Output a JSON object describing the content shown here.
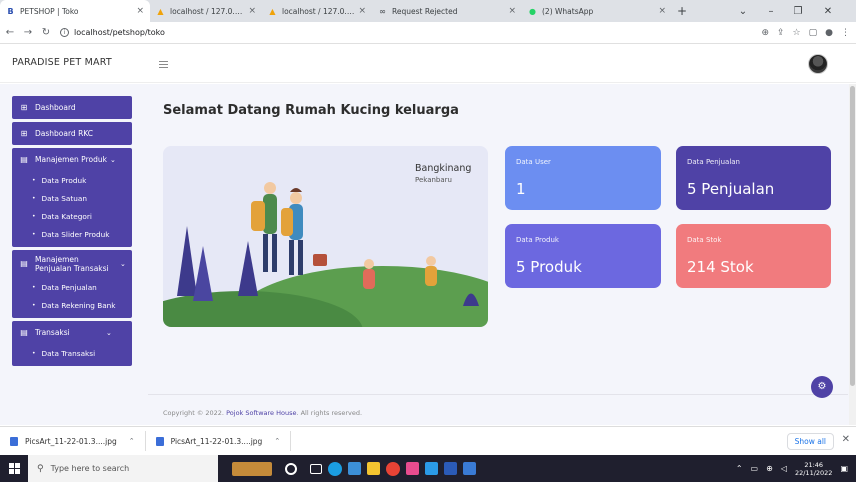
{
  "browser": {
    "tabs": [
      {
        "label": "PETSHOP | Toko",
        "icon": "b-icon",
        "active": true
      },
      {
        "label": "localhost / 127.0.0.1 / petsho",
        "icon": "phpmyadmin-icon",
        "active": false
      },
      {
        "label": "localhost / 127.0.0.1 / petsho",
        "icon": "phpmyadmin-icon",
        "active": false
      },
      {
        "label": "Request Rejected",
        "icon": "link-icon",
        "active": false
      },
      {
        "label": "(2) WhatsApp",
        "icon": "whatsapp-icon",
        "active": false
      }
    ],
    "url": "localhost/petshop/toko"
  },
  "navbar": {
    "brand": "PARADISE PET MART"
  },
  "sidebar": {
    "dashboard": "Dashboard",
    "dashboard_rkc": "Dashboard RKC",
    "groups": [
      {
        "label": "Manajemen Produk",
        "items": [
          "Data Produk",
          "Data Satuan",
          "Data Kategori",
          "Data Slider Produk"
        ]
      },
      {
        "label": "Manajemen Penjualan Transaksi",
        "items": [
          "Data Penjualan",
          "Data Rekening Bank"
        ]
      },
      {
        "label": "Transaksi",
        "items": [
          "Data Transaksi"
        ]
      }
    ]
  },
  "main": {
    "welcome": "Selamat Datang Rumah Kucing keluarga",
    "hero": {
      "city": "Bangkinang",
      "sub": "Pekanbaru"
    },
    "cards": [
      {
        "label": "Data User",
        "value": "1",
        "color": "#6c8ef1"
      },
      {
        "label": "Data Penjualan",
        "value": "5 Penjualan",
        "color": "#4f42a6"
      },
      {
        "label": "Data Produk",
        "value": "5 Produk",
        "color": "#6c68e0"
      },
      {
        "label": "Data Stok",
        "value": "214 Stok",
        "color": "#f17b7e"
      }
    ],
    "footer_prefix": "Copyright © 2022.",
    "footer_link": "Pojok Software House",
    "footer_suffix": ". All rights reserved."
  },
  "downloads": {
    "items": [
      "PicsArt_11-22-01.3....jpg",
      "PicsArt_11-22-01.3....jpg"
    ],
    "show_all": "Show all"
  },
  "taskbar": {
    "search_placeholder": "Type here to search",
    "time": "21:46",
    "date": "22/11/2022"
  },
  "colors": {
    "accent": "#4f42a6",
    "background": "#f4f5fb"
  }
}
